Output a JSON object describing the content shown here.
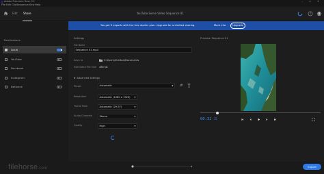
{
  "titlebar": {
    "title": "Adobe Premiere Rush CC"
  },
  "menu": {
    "items": [
      "File",
      "Edit",
      "Clip",
      "Sequence",
      "View",
      "Help"
    ]
  },
  "tabs": [
    {
      "label": "Edit",
      "active": false
    },
    {
      "label": "Share",
      "active": true
    }
  ],
  "document_title": "YouTube Serve Video Sequence 01",
  "banner": {
    "message": "You get 3 exports with the free starter plan. Upgrade for unlimited sharing.",
    "more_info": "More info",
    "upgrade": "Upgrade",
    "color": "#1d4fa8"
  },
  "sidebar": {
    "title": "Destinations",
    "items": [
      {
        "label": "Local",
        "checked": true,
        "enabled": true
      },
      {
        "label": "YouTube",
        "checked": false,
        "enabled": false
      },
      {
        "label": "Facebook",
        "checked": false,
        "enabled": false
      },
      {
        "label": "Instagram",
        "checked": false,
        "enabled": false
      },
      {
        "label": "Behance",
        "checked": false,
        "enabled": false
      }
    ]
  },
  "settings": {
    "title": "Settings",
    "file_name_label": "File Name",
    "file_name_value": "Sequence 01.mp4",
    "save_to_label": "Save to",
    "save_to_value": "C:\\Users\\Chellian\\Documents",
    "est_size_label": "Estimated File Size",
    "est_size_value": "486 KB",
    "advanced_label": "Advanced Settings",
    "preset_label": "Preset",
    "preset_value": "Automatic",
    "rows": [
      {
        "label": "Resolution",
        "value": "Automatic (1080 x 1920)"
      },
      {
        "label": "Frame Rate",
        "value": "Automatic (29.97)"
      },
      {
        "label": "Audio Channels",
        "value": "Stereo"
      },
      {
        "label": "Quality",
        "value": "High"
      }
    ]
  },
  "preview": {
    "title": "Preview: Sequence 01",
    "timecode_main": "00:32",
    "timecode_frames": "15",
    "progress": 0.14
  },
  "footer": {
    "watermark": "filehorse",
    "watermark_suffix": ".com",
    "export_label": "Export",
    "pages": 3,
    "current_page": 1
  },
  "colors": {
    "accent": "#2f7ae5",
    "timecode": "#3b8fff",
    "sidebar_active": "#393939"
  }
}
